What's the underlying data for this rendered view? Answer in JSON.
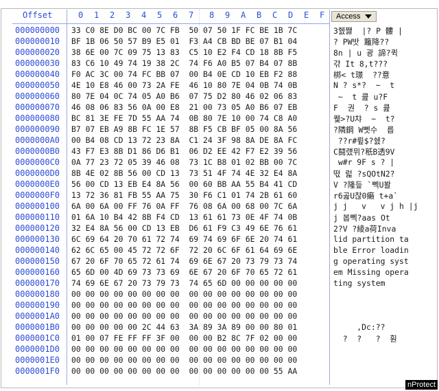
{
  "header": {
    "offset_label": "Offset",
    "columns": [
      "0",
      "1",
      "2",
      "3",
      "4",
      "5",
      "6",
      "7",
      "8",
      "9",
      "A",
      "B",
      "C",
      "D",
      "E",
      "F"
    ],
    "access_label": "Access"
  },
  "rows": [
    {
      "off": "000000000",
      "hex": "33 C0 8E D0 BC 00 7C FB  50 07 50 1F FC BE 1B 7C",
      "asc": "3쥀쨇  |? P 髏 |"
    },
    {
      "off": "000000010",
      "hex": "BF 1B 06 50 57 B9 E5 01  F3 A4 CB BD BE 07 B1 04",
      "asc": "? PW밧 籬降??"
    },
    {
      "off": "000000020",
      "hex": "38 6E 00 7C 09 75 13 83  C5 10 E2 F4 CD 18 8B F5",
      "asc": "8n | u 광 諦?퀵"
    },
    {
      "off": "000000030",
      "hex": "83 C6 10 49 74 19 38 2C  74 F6 A0 B5 07 B4 07 8B",
      "asc": "갺 It 8,t???"
    },
    {
      "off": "000000040",
      "hex": "F0 AC 3C 00 74 FC BB 07  00 B4 0E CD 10 EB F2 88",
      "asc": "梆< t璟  ??意"
    },
    {
      "off": "000000050",
      "hex": "4E 10 E8 46 00 73 2A FE  46 10 80 7E 04 0B 74 0B",
      "asc": "N ? s*?  ~  t"
    },
    {
      "off": "000000060",
      "hex": "80 7E 04 0C 74 05 A0 B6  07 75 D2 80 46 02 06 83",
      "asc": " ~  t 쿒 u?F"
    },
    {
      "off": "000000070",
      "hex": "46 08 06 83 56 0A 00 E8  21 00 73 05 A0 B6 07 EB",
      "asc": "F  권  ? s 쿒"
    },
    {
      "off": "000000080",
      "hex": "BC 81 3E FE 7D 55 AA 74  0B 80 7E 10 00 74 C8 A0",
      "asc": "퀮>?U챠  ~  t?"
    },
    {
      "off": "000000090",
      "hex": "B7 07 EB A9 8B FC 1E 57  8B F5 CB BF 05 00 8A 56",
      "asc": "?隣鋼 W뻿수  릅"
    },
    {
      "off": "0000000A0",
      "hex": "00 B4 08 CD 13 72 23 8A  C1 24 3F 98 8A DE 8A FC",
      "asc": " ??r#륖$?쉜?"
    },
    {
      "off": "0000000B0",
      "hex": "43 F7 E3 8B D1 86 D6 B1  06 D2 EE 42 F7 E2 39 56",
      "asc": "C鬪럤뮈?秖B透9V"
    },
    {
      "off": "0000000C0",
      "hex": "0A 77 23 72 05 39 46 08  73 1C B8 01 02 BB 00 7C",
      "asc": " w#r 9F s ? |"
    },
    {
      "off": "0000000D0",
      "hex": "8B 4E 02 8B 56 00 CD 13  73 51 4F 74 4E 32 E4 8A",
      "asc": "떣 럷 ?sQOtN2?"
    },
    {
      "off": "0000000E0",
      "hex": "56 00 CD 13 EB E4 8A 56  00 60 BB AA 55 B4 41 CD",
      "asc": "V ?隆듶 `뻭U봘"
    },
    {
      "off": "0000000F0",
      "hex": "13 72 36 81 FB 55 AA 75  30 F6 C1 01 74 2B 61 60",
      "asc": "r6곮U챦0癩 t+a`"
    },
    {
      "off": "000000100",
      "hex": "6A 00 6A 00 FF 76 0A FF  76 08 6A 00 68 00 7C 6A",
      "asc": "j j   v   v j h |j"
    },
    {
      "off": "000000110",
      "hex": "01 6A 10 B4 42 8B F4 CD  13 61 61 73 0E 4F 74 0B",
      "asc": "j 봅뻭?aas Ot"
    },
    {
      "off": "000000120",
      "hex": "32 E4 8A 56 00 CD 13 EB  D6 61 F9 C3 49 6E 76 61",
      "asc": "2?V ?綾a荷Inva"
    },
    {
      "off": "000000130",
      "hex": "6C 69 64 20 70 61 72 74  69 74 69 6F 6E 20 74 61",
      "asc": "lid partition ta"
    },
    {
      "off": "000000140",
      "hex": "62 6C 65 00 45 72 72 6F  72 20 6C 6F 61 64 69 6E",
      "asc": "ble Error loadin"
    },
    {
      "off": "000000150",
      "hex": "67 20 6F 70 65 72 61 74  69 6E 67 20 73 79 73 74",
      "asc": "g operating syst"
    },
    {
      "off": "000000160",
      "hex": "65 6D 00 4D 69 73 73 69  6E 67 20 6F 70 65 72 61",
      "asc": "em Missing opera"
    },
    {
      "off": "000000170",
      "hex": "74 69 6E 67 20 73 79 73  74 65 6D 00 00 00 00 00",
      "asc": "ting system"
    },
    {
      "off": "000000180",
      "hex": "00 00 00 00 00 00 00 00  00 00 00 00 00 00 00 00",
      "asc": ""
    },
    {
      "off": "000000190",
      "hex": "00 00 00 00 00 00 00 00  00 00 00 00 00 00 00 00",
      "asc": ""
    },
    {
      "off": "0000001A0",
      "hex": "00 00 00 00 00 00 00 00  00 00 00 00 00 00 00 00",
      "asc": ""
    },
    {
      "off": "0000001B0",
      "hex": "00 00 00 00 00 2C 44 63  3A 89 3A 89 00 00 80 01",
      "asc": "     ,Dc:??"
    },
    {
      "off": "0000001C0",
      "hex": "01 00 07 FE FF FF 3F 00  00 00 B2 8C 7F 02 00 00",
      "asc": "  ?  ?   ?  훤"
    },
    {
      "off": "0000001D0",
      "hex": "00 00 00 00 00 00 00 00  00 00 00 00 00 00 00 00",
      "asc": ""
    },
    {
      "off": "0000001E0",
      "hex": "00 00 00 00 00 00 00 00  00 00 00 00 00 00 00 00",
      "asc": ""
    },
    {
      "off": "0000001F0",
      "hex": "00 00 00 00 00 00 00 00  00 00 00 00 00 00 55 AA",
      "asc": ""
    }
  ],
  "footer": {
    "label": "nProtect"
  },
  "colors": {
    "accent": "#2a4bd7",
    "text": "#1a1a1a",
    "frame": "#b8b8b8"
  }
}
